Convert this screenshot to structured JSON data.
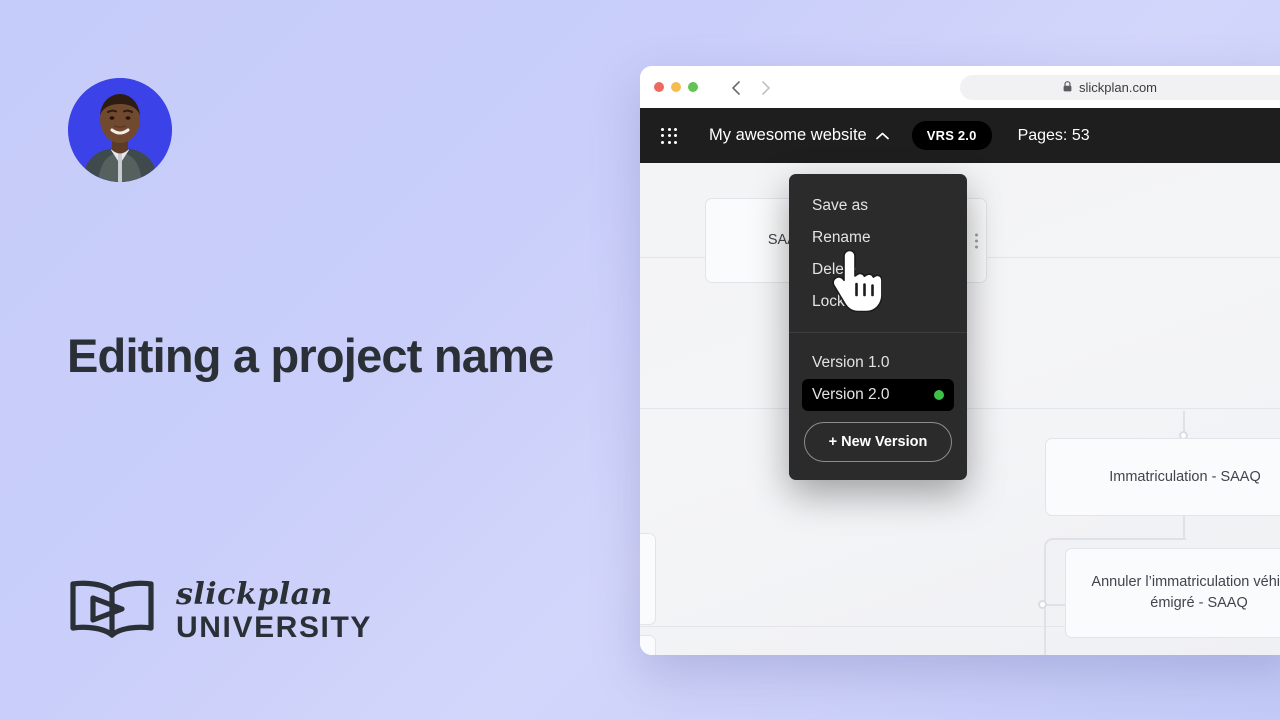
{
  "theme": {
    "page_bg_start": "#c6ccf9",
    "page_bg_end": "#c4cbf8",
    "headline_color": "#2b2f36",
    "appbar_bg": "#1e1e1e",
    "menu_bg": "#2b2b2b",
    "active_version_bg": "#000000",
    "version_dot_green": "#3ec14a",
    "canvas_bg": "#f3f4f6"
  },
  "left_panel": {
    "headline": "Editing a project name",
    "avatar_alt": "presenter-avatar",
    "brand": {
      "script": "slickplan",
      "word": "UNIVERSITY",
      "mark": "open-book-play-icon"
    }
  },
  "browser": {
    "traffic_lights": [
      "close",
      "minimize",
      "zoom"
    ],
    "nav": {
      "back": "back-chevron",
      "forward": "forward-chevron"
    },
    "url": "slickplan.com",
    "lock_icon": "lock-icon"
  },
  "appbar": {
    "grid_icon": "apps-grid-icon",
    "project_name": "My awesome website",
    "chevron": "chevron-up-icon",
    "version_badge": "VRS 2.0",
    "pages_label": "Pages: 53"
  },
  "dropdown": {
    "actions": [
      {
        "label": "Save as",
        "name": "menu-item-save-as"
      },
      {
        "label": "Rename",
        "name": "menu-item-rename"
      },
      {
        "label": "Delete",
        "name": "menu-item-delete"
      },
      {
        "label": "Lock",
        "name": "menu-item-lock"
      }
    ],
    "versions": [
      {
        "label": "Version 1.0",
        "active": false
      },
      {
        "label": "Version 2.0",
        "active": true
      }
    ],
    "new_version_label": "+ New Version"
  },
  "canvas": {
    "nodes": [
      {
        "text": "SAAQ - automobile et ...",
        "name": "sitemap-node-saaq"
      },
      {
        "text": "Immatriculation - SAAQ",
        "name": "sitemap-node-immatriculation"
      },
      {
        "text": "Annuler l’immatriculation véhicule émigré - SAAQ",
        "name": "sitemap-node-annuler"
      }
    ]
  },
  "cursor": {
    "type": "pointing-hand-cursor"
  }
}
